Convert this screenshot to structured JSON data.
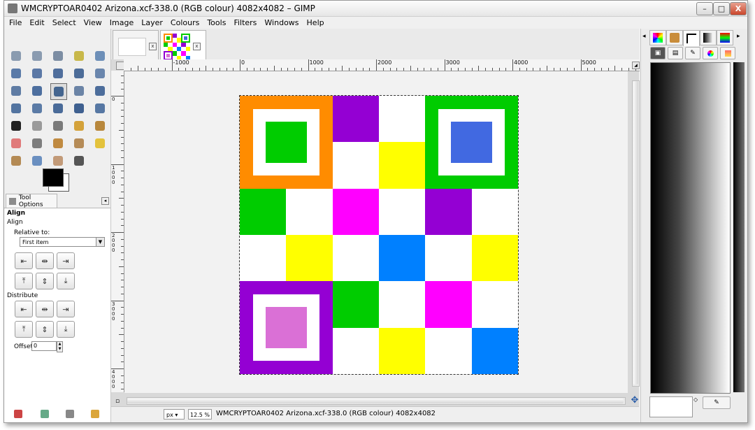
{
  "window": {
    "title": "WMCRYPTOAR0402 Arizona.xcf-338.0 (RGB colour) 4082x4082 – GIMP",
    "minimize": "–",
    "maximize": "□",
    "close": "X"
  },
  "menu": [
    "File",
    "Edit",
    "Select",
    "View",
    "Image",
    "Layer",
    "Colours",
    "Tools",
    "Filters",
    "Windows",
    "Help"
  ],
  "toolbox": {
    "tools": [
      {
        "name": "rect-select-icon",
        "color": "#8a9bb0"
      },
      {
        "name": "ellipse-select-icon",
        "color": "#8a9bb0"
      },
      {
        "name": "free-select-icon",
        "color": "#7c8da3"
      },
      {
        "name": "fuzzy-select-icon",
        "color": "#c8b84a"
      },
      {
        "name": "by-color-select-icon",
        "color": "#6d8fb8"
      },
      {
        "name": "scissors-icon",
        "color": "#5a7aa8"
      },
      {
        "name": "foreground-select-icon",
        "color": "#5b78a6"
      },
      {
        "name": "paths-icon",
        "color": "#4f6e9c"
      },
      {
        "name": "color-picker-icon",
        "color": "#4c6c98"
      },
      {
        "name": "zoom-icon",
        "color": "#6a86ad"
      },
      {
        "name": "measure-icon",
        "color": "#5f7ca4"
      },
      {
        "name": "move-icon",
        "color": "#4d6f9f"
      },
      {
        "name": "align-icon",
        "color": "#44658f"
      },
      {
        "name": "crop-icon",
        "color": "#6b84a6"
      },
      {
        "name": "rotate-icon",
        "color": "#4c6d9b"
      },
      {
        "name": "scale-icon",
        "color": "#5374a0"
      },
      {
        "name": "shear-icon",
        "color": "#5b7ba6"
      },
      {
        "name": "perspective-icon",
        "color": "#4a6b99"
      },
      {
        "name": "flip-icon",
        "color": "#3f6090"
      },
      {
        "name": "cage-icon",
        "color": "#5677a3"
      },
      {
        "name": "text-icon",
        "color": "#222222"
      },
      {
        "name": "bucket-fill-icon",
        "color": "#9a9a9a"
      },
      {
        "name": "blend-icon",
        "color": "#7a7a7a"
      },
      {
        "name": "pencil-icon",
        "color": "#d4a23a"
      },
      {
        "name": "paintbrush-icon",
        "color": "#b8873c"
      },
      {
        "name": "eraser-icon",
        "color": "#e07a7a"
      },
      {
        "name": "airbrush-icon",
        "color": "#7d7d7d"
      },
      {
        "name": "ink-icon",
        "color": "#c08a40"
      },
      {
        "name": "clone-icon",
        "color": "#b58b57"
      },
      {
        "name": "heal-icon",
        "color": "#e3c23c"
      },
      {
        "name": "perspective-clone-icon",
        "color": "#b48a54"
      },
      {
        "name": "blur-icon",
        "color": "#6a8fc0"
      },
      {
        "name": "smudge-icon",
        "color": "#c29a78"
      },
      {
        "name": "dodge-burn-icon",
        "color": "#555555"
      }
    ],
    "tab_label": "Tool Options",
    "tool_name": "Align",
    "tool_subtitle": "Align",
    "relative_to_label": "Relative to:",
    "relative_to_value": "First item",
    "distribute_label": "Distribute",
    "offset_label": "Offset:",
    "offset_value": "0"
  },
  "image_tabs": [
    {
      "label": "image-tab-blank"
    },
    {
      "label": "image-tab-arizona"
    }
  ],
  "ruler": {
    "h_labels": [
      "-1000",
      "0",
      "1000",
      "2000",
      "3000",
      "4000",
      "5000"
    ],
    "v_labels": [
      "0",
      "1000",
      "2000",
      "3000",
      "4000"
    ]
  },
  "status": {
    "unit": "px",
    "zoom": "12.5 %",
    "text": "WMCRYPTOAR0402 Arizona.xcf-338.0 (RGB colour) 4082x4082"
  },
  "image_cells": [
    {
      "color": "#ff8c00",
      "kind": "square3",
      "inner": "#ffffff",
      "core": "#00cc00",
      "r": 0,
      "c": 0
    },
    {
      "color": "#9400d3",
      "r": 0,
      "c": 2
    },
    {
      "color": "#ffffff",
      "r": 0,
      "c": 3
    },
    {
      "color": "#00cc00",
      "kind": "square3",
      "inner": "#ffffff",
      "core": "#4169e1",
      "r": 0,
      "c": 4
    },
    {
      "color": "#ffffff",
      "r": 1,
      "c": 2
    },
    {
      "color": "#ffff00",
      "r": 1,
      "c": 3
    },
    {
      "color": "#00cc00",
      "r": 2,
      "c": 0
    },
    {
      "color": "#ffffff",
      "r": 2,
      "c": 1
    },
    {
      "color": "#ff00ff",
      "r": 2,
      "c": 2
    },
    {
      "color": "#ffffff",
      "r": 2,
      "c": 3
    },
    {
      "color": "#9400d3",
      "r": 2,
      "c": 4
    },
    {
      "color": "#ffffff",
      "r": 2,
      "c": 5
    },
    {
      "color": "#ffffff",
      "r": 3,
      "c": 0
    },
    {
      "color": "#ffff00",
      "r": 3,
      "c": 1
    },
    {
      "color": "#ffffff",
      "r": 3,
      "c": 2
    },
    {
      "color": "#0080ff",
      "r": 3,
      "c": 3
    },
    {
      "color": "#ffffff",
      "r": 3,
      "c": 4
    },
    {
      "color": "#ffff00",
      "r": 3,
      "c": 5
    },
    {
      "color": "#9400d3",
      "kind": "square3",
      "inner": "#ffffff",
      "core": "#da70d6",
      "r": 4,
      "c": 0
    },
    {
      "color": "#00cc00",
      "r": 4,
      "c": 2
    },
    {
      "color": "#ffffff",
      "r": 4,
      "c": 3
    },
    {
      "color": "#ff00ff",
      "r": 4,
      "c": 4
    },
    {
      "color": "#ffffff",
      "r": 4,
      "c": 5
    },
    {
      "color": "#ffffff",
      "r": 5,
      "c": 2
    },
    {
      "color": "#ffff00",
      "r": 5,
      "c": 3
    },
    {
      "color": "#ffffff",
      "r": 5,
      "c": 4
    },
    {
      "color": "#0080ff",
      "r": 5,
      "c": 5
    }
  ],
  "dock": {
    "tabs": [
      "palette-icon",
      "patterns-icon",
      "brushes-icon",
      "gradients-icon",
      "colormap-icon"
    ],
    "subtabs": [
      "tool-options-dock-icon",
      "device-status-icon",
      "paint-dynamics-icon",
      "color-icon",
      "fonts-icon"
    ]
  }
}
